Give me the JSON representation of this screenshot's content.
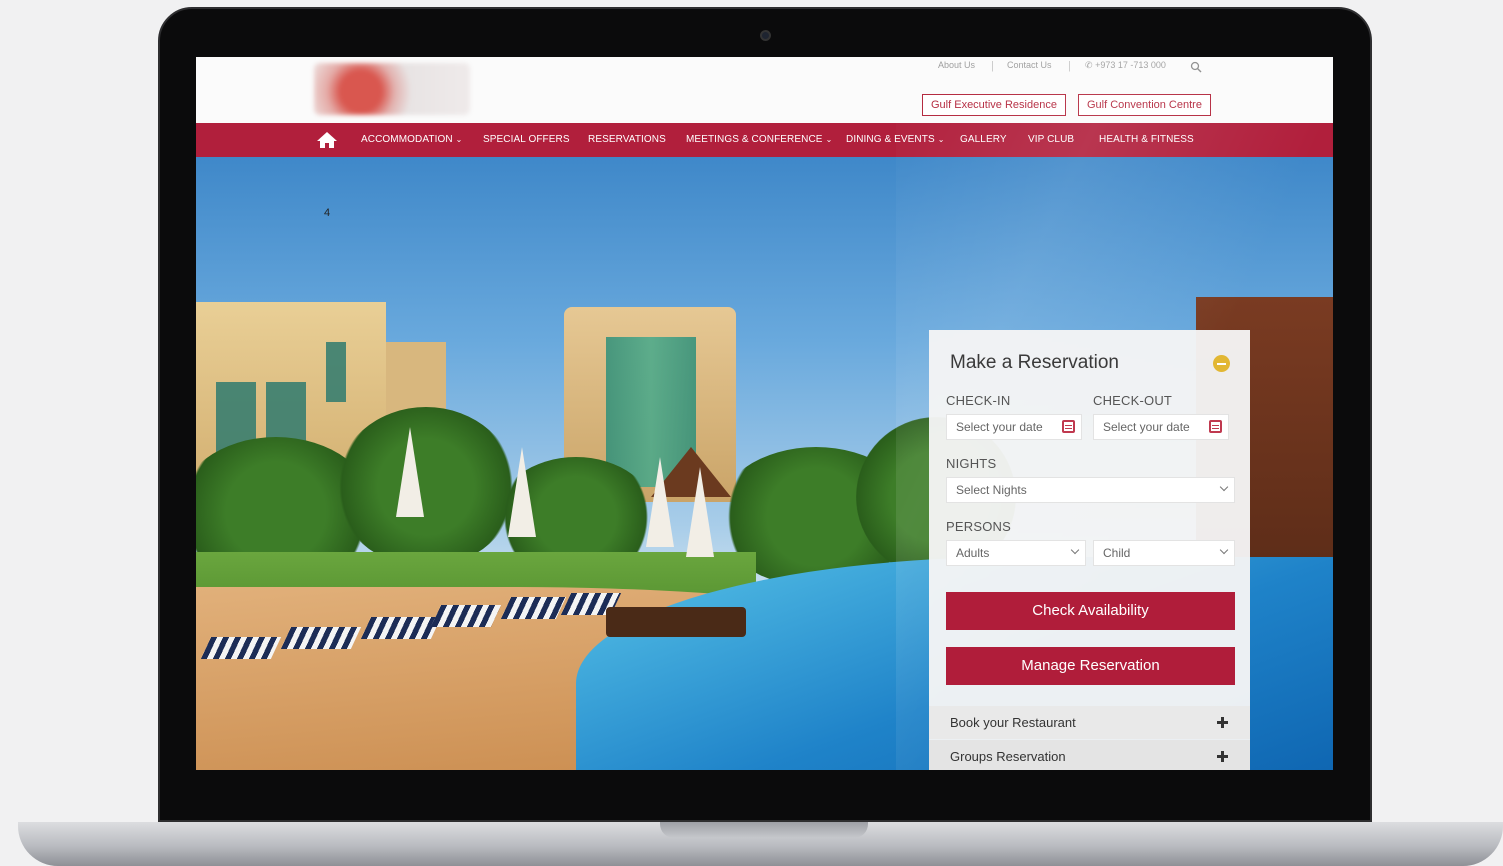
{
  "header": {
    "about_label": "About Us",
    "contact_label": "Contact Us",
    "phone": "+973 17 -713 000",
    "buttons": [
      "Gulf Executive Residence",
      "Gulf Convention Centre"
    ]
  },
  "nav": {
    "items": [
      {
        "label": "ACCOMMODATION",
        "has_caret": true
      },
      {
        "label": "SPECIAL OFFERS",
        "has_caret": false
      },
      {
        "label": "RESERVATIONS",
        "has_caret": false
      },
      {
        "label": "MEETINGS & CONFERENCE",
        "has_caret": true
      },
      {
        "label": "DINING & EVENTS",
        "has_caret": true
      },
      {
        "label": "GALLERY",
        "has_caret": false
      },
      {
        "label": "VIP CLUB",
        "has_caret": false
      },
      {
        "label": "HEALTH & FITNESS",
        "has_caret": false
      }
    ],
    "caret_glyph": "⌄"
  },
  "hero": {
    "cursor_glyph": "4"
  },
  "reservation": {
    "title": "Make a Reservation",
    "checkin_label": "CHECK-IN",
    "checkout_label": "CHECK-OUT",
    "checkin_placeholder": "Select your date",
    "checkout_placeholder": "Select your date",
    "nights_label": "NIGHTS",
    "nights_value": "Select Nights",
    "persons_label": "PERSONS",
    "adults_value": "Adults",
    "child_value": "Child",
    "check_availability": "Check Availability",
    "manage_reservation": "Manage Reservation",
    "accordion": [
      "Book your Restaurant",
      "Groups Reservation"
    ]
  },
  "colors": {
    "brand_red": "#b11f3c",
    "accent_gold": "#e2b733"
  }
}
